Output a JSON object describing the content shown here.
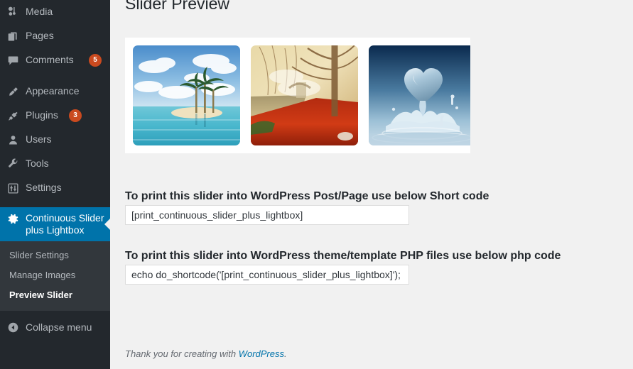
{
  "sidebar": {
    "items": [
      {
        "label": "Media",
        "icon": "media-icon",
        "badge": null
      },
      {
        "label": "Pages",
        "icon": "pages-icon",
        "badge": null
      },
      {
        "label": "Comments",
        "icon": "comments-icon",
        "badge": "5"
      },
      {
        "label": "Appearance",
        "icon": "appearance-brush-icon",
        "badge": null
      },
      {
        "label": "Plugins",
        "icon": "plugins-plug-icon",
        "badge": "3"
      },
      {
        "label": "Users",
        "icon": "users-icon",
        "badge": null
      },
      {
        "label": "Tools",
        "icon": "tools-wrench-icon",
        "badge": null
      },
      {
        "label": "Settings",
        "icon": "settings-sliders-icon",
        "badge": null
      }
    ],
    "current": {
      "label": "Continuous Slider plus Lightbox",
      "icon": "gear-icon",
      "accent_color": "#0073aa"
    },
    "submenu": [
      {
        "label": "Slider Settings",
        "active": false
      },
      {
        "label": "Manage Images",
        "active": false
      },
      {
        "label": "Preview Slider",
        "active": true
      }
    ],
    "collapse": {
      "label": "Collapse menu",
      "icon": "collapse-arrow-icon"
    },
    "background_color": "#23282d",
    "submenu_background_color": "#32373c",
    "badge_color": "#ca4a1f"
  },
  "main": {
    "title": "Slider Preview",
    "slider": {
      "slides": [
        {
          "name": "tropical-island-palms",
          "alt": "Tropical island with palm trees in turquoise sea"
        },
        {
          "name": "autumn-forest-red-leaves",
          "alt": "Misty autumn forest with red leaves by a river"
        },
        {
          "name": "water-heart-splash",
          "alt": "Water splash shaped like a heart on dark blue"
        }
      ]
    },
    "shortcode_section": {
      "heading": "To print this slider into WordPress Post/Page use below Short code",
      "value": "[print_continuous_slider_plus_lightbox]",
      "placeholder": "[print_continuous_slider_plus_lightbox]"
    },
    "php_section": {
      "heading": "To print this slider into WordPress theme/template PHP files use below php code",
      "value": "echo do_shortcode('[print_continuous_slider_plus_lightbox]');",
      "placeholder": "echo do_shortcode('[print_continuous_slider_plus_lightbox]');"
    },
    "footer": {
      "prefix": "Thank you for creating with ",
      "link": "WordPress",
      "suffix": ".",
      "link_color": "#0073aa"
    }
  }
}
